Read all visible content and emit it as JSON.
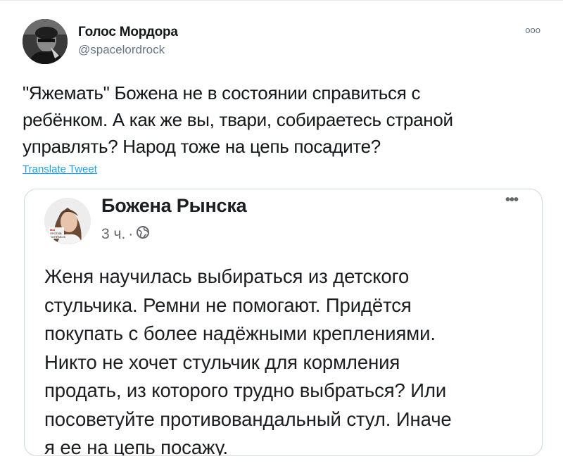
{
  "tweet": {
    "author_name": "Голос Мордора",
    "author_handle": "@spacelordrock",
    "more_icon": "ooo",
    "text_lines": [
      "\"Яжемать\" Божена не в состоянии справиться с",
      "ребёнком. А как же вы, твари, собираетесь страной",
      "управлять? Народ тоже на цепь посадите?"
    ],
    "translate_label": "Translate Tweet"
  },
  "quote": {
    "author_name": "Божена Рынска",
    "time": "3 ч.",
    "separator": "·",
    "privacy_icon": "globe-icon",
    "more_icon": "•••",
    "avatar_badge_lines": [
      "МЫ",
      "ПРОТИВ",
      "ПОПРАВОК"
    ],
    "text_lines": [
      "Женя научилась выбираться из детского",
      "стульчика. Ремни не помогают. Придётся",
      "покупать с более надёжными креплениями.",
      "Никто не хочет стульчик для кормления",
      "продать, из которого трудно выбраться? Или",
      "посоветуйте противовандальный стул. Иначе",
      "я ее на цепь посажу."
    ]
  },
  "colors": {
    "text_primary": "#14171a",
    "text_secondary": "#657786",
    "link": "#1da1f2",
    "border": "#cfd9de"
  }
}
